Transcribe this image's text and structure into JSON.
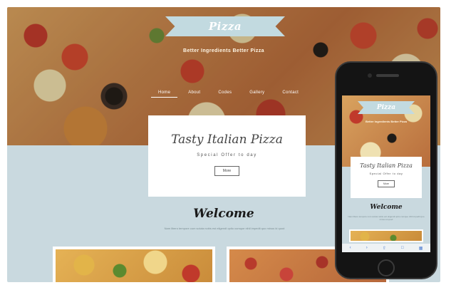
{
  "site": {
    "logo_text": "Pizza",
    "tagline": "Better Ingredients Better Pizza",
    "nav": [
      "Home",
      "About",
      "Codes",
      "Gallery",
      "Contact"
    ],
    "active_nav": "Home"
  },
  "feature": {
    "title": "Tasty Italian Pizza",
    "subtitle": "Special Offer to day",
    "button_label": "More"
  },
  "welcome": {
    "heading": "Welcome",
    "text": "Nam libero tempore cum soluta nobis est eligendi optio cumque nihil impedit quo minus id quod"
  },
  "mobile": {
    "logo_text": "Pizza",
    "tagline": "Better Ingredients Better Pizza",
    "title": "Tasty Italian Pizza",
    "subtitle": "Special Offer to day",
    "button_label": "More",
    "welcome_heading": "Welcome",
    "welcome_text": "Nam libero tempore cum soluta nobis est eligendi optio cumque nihil impedit quo minus id quod",
    "toolbar_icons": [
      "back-icon",
      "forward-icon",
      "share-icon",
      "bookmarks-icon",
      "tabs-icon"
    ]
  },
  "colors": {
    "background": "#c9d9df",
    "ribbon": "#c2dae0",
    "card": "#ffffff",
    "heading_text": "#1a1a1a",
    "phone_body": "#141414"
  }
}
